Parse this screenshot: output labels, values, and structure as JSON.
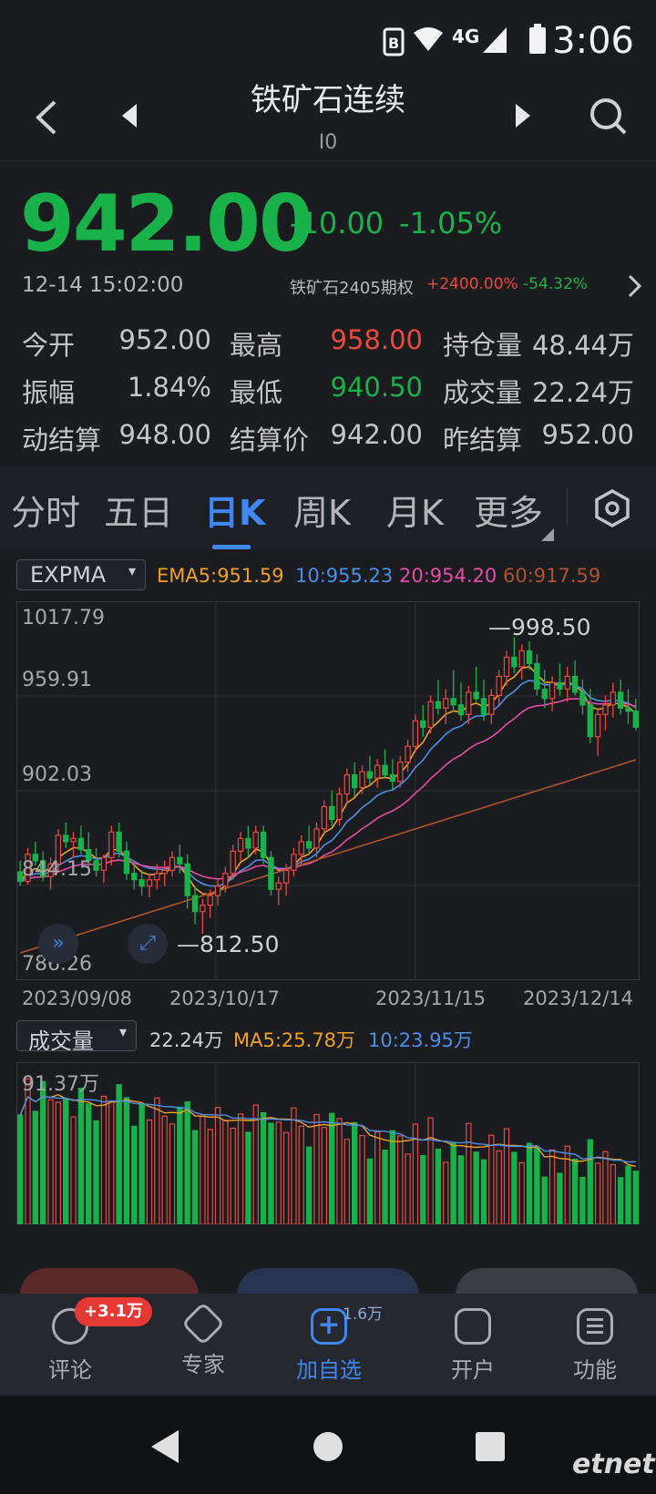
{
  "status_bar": {
    "time": "3:06",
    "network": "4G"
  },
  "header": {
    "title": "铁矿石连续",
    "code": "I0"
  },
  "quote": {
    "price": "942.00",
    "change": "-10.00",
    "change_pct": "-1.05%",
    "datetime": "12-14 15:02:00",
    "option_name": "铁矿石2405期权",
    "option_up": "+2400.00%",
    "option_down": "-54.32%",
    "stats": [
      [
        {
          "label": "今开",
          "value": "952.00",
          "color": "neutral"
        },
        {
          "label": "最高",
          "value": "958.00",
          "color": "red"
        },
        {
          "label": "持仓量",
          "value": "48.44万",
          "color": "neutral"
        }
      ],
      [
        {
          "label": "振幅",
          "value": "1.84%",
          "color": "neutral"
        },
        {
          "label": "最低",
          "value": "940.50",
          "color": "green"
        },
        {
          "label": "成交量",
          "value": "22.24万",
          "color": "neutral"
        }
      ],
      [
        {
          "label": "动结算",
          "value": "948.00",
          "color": "neutral"
        },
        {
          "label": "结算价",
          "value": "942.00",
          "color": "neutral"
        },
        {
          "label": "昨结算",
          "value": "952.00",
          "color": "neutral"
        }
      ]
    ]
  },
  "period_tabs": [
    "分时",
    "五日",
    "日K",
    "周K",
    "月K",
    "更多"
  ],
  "active_period": "日K",
  "main_indicator": {
    "name": "EXPMA",
    "ema5": "EMA5:951.59",
    "ema10": "10:955.23",
    "ema20": "20:954.20",
    "ema60": "60:917.59",
    "colors": {
      "ema5": "#f0a020",
      "ema10": "#4a8fe8",
      "ema20": "#e84aa8",
      "ema60": "#b0522a",
      "up": "#e9493f",
      "down": "#19b24a"
    }
  },
  "price_axis": [
    "1017.79",
    "959.91",
    "902.03",
    "844.15",
    "786.26"
  ],
  "high_label": "998.50",
  "low_label": "812.50",
  "dates": [
    "2023/09/08",
    "2023/10/17",
    "2023/11/15",
    "2023/12/14"
  ],
  "volume_indicator": {
    "name": "成交量",
    "current": "22.24万",
    "ma5": "MA5:25.78万",
    "ma10": "10:23.95万",
    "max_label": "91.37万"
  },
  "chart_data": {
    "type": "candlestick",
    "ylim": [
      786.26,
      1017.79
    ],
    "ohlc": [
      [
        851,
        858,
        842,
        845
      ],
      [
        845,
        866,
        843,
        862
      ],
      [
        862,
        870,
        855,
        858
      ],
      [
        858,
        864,
        845,
        848
      ],
      [
        848,
        860,
        840,
        856
      ],
      [
        856,
        878,
        852,
        874
      ],
      [
        874,
        882,
        866,
        870
      ],
      [
        870,
        876,
        860,
        872
      ],
      [
        872,
        880,
        862,
        865
      ],
      [
        865,
        876,
        854,
        858
      ],
      [
        858,
        866,
        848,
        852
      ],
      [
        852,
        862,
        844,
        860
      ],
      [
        860,
        880,
        855,
        876
      ],
      [
        876,
        882,
        860,
        864
      ],
      [
        864,
        870,
        846,
        850
      ],
      [
        850,
        858,
        840,
        846
      ],
      [
        846,
        852,
        836,
        842
      ],
      [
        842,
        850,
        835,
        846
      ],
      [
        846,
        856,
        840,
        850
      ],
      [
        850,
        858,
        842,
        852
      ],
      [
        852,
        864,
        848,
        860
      ],
      [
        860,
        868,
        850,
        856
      ],
      [
        856,
        862,
        828,
        836
      ],
      [
        836,
        842,
        818,
        826
      ],
      [
        826,
        834,
        812,
        830
      ],
      [
        830,
        840,
        822,
        836
      ],
      [
        836,
        846,
        830,
        842
      ],
      [
        842,
        854,
        838,
        850
      ],
      [
        850,
        868,
        846,
        864
      ],
      [
        864,
        876,
        858,
        872
      ],
      [
        872,
        880,
        860,
        866
      ],
      [
        866,
        880,
        862,
        876
      ],
      [
        876,
        880,
        856,
        860
      ],
      [
        860,
        864,
        836,
        840
      ],
      [
        840,
        848,
        830,
        844
      ],
      [
        844,
        856,
        836,
        852
      ],
      [
        852,
        866,
        848,
        862
      ],
      [
        862,
        874,
        856,
        870
      ],
      [
        870,
        880,
        862,
        866
      ],
      [
        866,
        882,
        860,
        878
      ],
      [
        878,
        896,
        874,
        892
      ],
      [
        892,
        902,
        880,
        884
      ],
      [
        884,
        904,
        880,
        900
      ],
      [
        900,
        916,
        894,
        912
      ],
      [
        912,
        920,
        898,
        904
      ],
      [
        904,
        918,
        900,
        914
      ],
      [
        914,
        924,
        906,
        910
      ],
      [
        910,
        922,
        904,
        918
      ],
      [
        918,
        928,
        910,
        912
      ],
      [
        912,
        922,
        902,
        908
      ],
      [
        908,
        924,
        904,
        920
      ],
      [
        920,
        934,
        914,
        930
      ],
      [
        930,
        950,
        926,
        946
      ],
      [
        946,
        956,
        936,
        942
      ],
      [
        942,
        962,
        938,
        958
      ],
      [
        958,
        972,
        950,
        954
      ],
      [
        954,
        966,
        944,
        960
      ],
      [
        960,
        978,
        952,
        956
      ],
      [
        956,
        970,
        946,
        950
      ],
      [
        950,
        968,
        944,
        964
      ],
      [
        964,
        980,
        958,
        960
      ],
      [
        960,
        972,
        946,
        950
      ],
      [
        950,
        966,
        944,
        962
      ],
      [
        962,
        978,
        956,
        974
      ],
      [
        974,
        990,
        968,
        986
      ],
      [
        986,
        998.5,
        976,
        980
      ],
      [
        980,
        994,
        972,
        990
      ],
      [
        990,
        996,
        978,
        982
      ],
      [
        982,
        988,
        962,
        966
      ],
      [
        966,
        978,
        954,
        960
      ],
      [
        960,
        974,
        952,
        970
      ],
      [
        970,
        982,
        962,
        966
      ],
      [
        966,
        980,
        958,
        974
      ],
      [
        974,
        984,
        962,
        964
      ],
      [
        964,
        972,
        950,
        956
      ],
      [
        956,
        966,
        932,
        936
      ],
      [
        936,
        954,
        924,
        950
      ],
      [
        950,
        962,
        940,
        956
      ],
      [
        956,
        970,
        948,
        964
      ],
      [
        964,
        972,
        950,
        954
      ],
      [
        954,
        966,
        944,
        952
      ],
      [
        952,
        960,
        940,
        942
      ]
    ],
    "volume_max": 91.37,
    "volume_unit": "万"
  },
  "trade_buttons": [],
  "bottom_nav": [
    {
      "label": "评论",
      "badge": "+3.1万"
    },
    {
      "label": "专家"
    },
    {
      "label": "加自选",
      "badge": "1.6万"
    },
    {
      "label": "开户"
    },
    {
      "label": "功能"
    }
  ],
  "watermark": "etnet 经济通"
}
